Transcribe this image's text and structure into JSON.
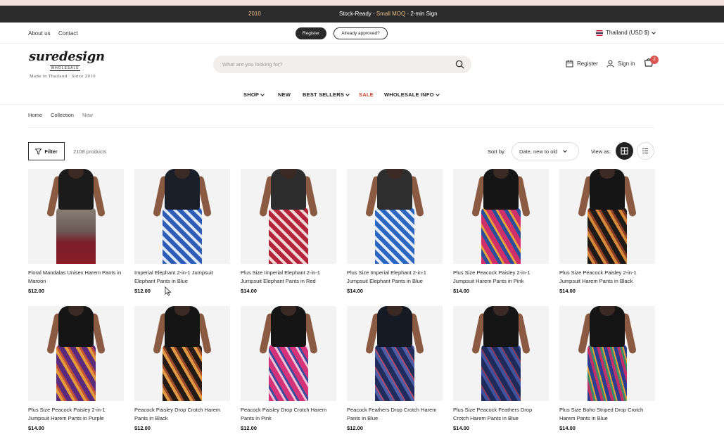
{
  "announcement": {
    "left_text": "2010",
    "text_before": "Stock-Ready · ",
    "text_accent": "Small MOQ",
    "text_after": " · 2-min Sign"
  },
  "utility": {
    "about": "About us",
    "contact": "Contact",
    "register": "Register",
    "approved": "Already approved?",
    "region": "Thailand (USD $)"
  },
  "header": {
    "logo_word": "suredesign",
    "logo_sub": "WHOLESALE",
    "logo_tag": "Made in Thailand · Since 2010",
    "search_placeholder": "What are you looking for?",
    "register": "Register",
    "signin": "Sign in",
    "cart_count": "2"
  },
  "nav": [
    {
      "label": "SHOP",
      "dropdown": true
    },
    {
      "label": "NEW",
      "dropdown": false
    },
    {
      "label": "BEST SELLERS",
      "dropdown": true
    },
    {
      "label": "SALE",
      "dropdown": false
    },
    {
      "label": "WHOLESALE INFO",
      "dropdown": true
    }
  ],
  "breadcrumb": {
    "home": "Home",
    "collection": "Collection",
    "current": "New"
  },
  "toolbar": {
    "filter": "Filter",
    "count": "2108 products",
    "sort_label": "Sort by:",
    "sort_value": "Date, new to old",
    "view_label": "View as:"
  },
  "products": [
    {
      "title": "Floral Mandalas Unisex Harem Pants in Maroon",
      "price": "$12.00",
      "top": "#1b1b1b",
      "pants": "linear-gradient(#8a7f77 0%, #6b5c58 40%, #7a1f2a 60%, #8a1c26 100%)"
    },
    {
      "title": "Imperial Elephant 2-in-1 Jumpsuit Elephant Pants in Blue",
      "price": "$12.00",
      "top": "#1a1f2a",
      "pants": "repeating-linear-gradient(45deg, #2c5cb8 0 6px, #dfe7f5 6px 10px)"
    },
    {
      "title": "Plus Size Imperial Elephant 2-in-1 Jumpsuit Elephant Pants in Red",
      "price": "$14.00",
      "top": "#2d2d2d",
      "pants": "repeating-linear-gradient(45deg, #b3243a 0 6px, #f1d6d6 6px 10px)"
    },
    {
      "title": "Plus Size Imperial Elephant 2-in-1 Jumpsuit Elephant Pants in Blue",
      "price": "$14.00",
      "top": "#2e2e2e",
      "pants": "repeating-linear-gradient(45deg, #2b66c2 0 6px, #e3ebf7 6px 10px)"
    },
    {
      "title": "Plus Size Peacock Paisley 2-in-1 Jumpsuit Harem Pants in Pink",
      "price": "$14.00",
      "top": "#151515",
      "pants": "repeating-linear-gradient(60deg, #d0306a 0 7px, #2a4e9b 7px 12px, #e8a23a 12px 15px)"
    },
    {
      "title": "Plus Size Peacock Paisley 2-in-1 Jumpsuit Harem Pants in Black",
      "price": "$14.00",
      "top": "#151515",
      "pants": "repeating-linear-gradient(60deg, #1e1a18 0 7px, #d48a3a 7px 11px, #8b3d26 11px 14px)"
    },
    {
      "title": "Plus Size Peacock Paisley 2-in-1 Jumpsuit Harem Pants in Purple",
      "price": "$14.00",
      "top": "#151515",
      "pants": "repeating-linear-gradient(60deg, #5a2a7d 0 7px, #e29a3a 7px 11px, #c0503a 11px 14px)"
    },
    {
      "title": "Peacock Paisley Drop Crotch Harem Pants in Black",
      "price": "$12.00",
      "top": "#151515",
      "pants": "repeating-linear-gradient(60deg, #231a16 0 7px, #e09a45 7px 11px, #9a4a2a 11px 14px)"
    },
    {
      "title": "Peacock Paisley Drop Crotch Harem Pants in Pink",
      "price": "$12.00",
      "top": "#151515",
      "pants": "repeating-linear-gradient(60deg, #d4337a 0 7px, #f3c2d6 7px 10px, #3a4c9b 10px 13px)"
    },
    {
      "title": "Peacock Feathers Drop Crotch Harem Pants in Blue",
      "price": "$12.00",
      "top": "#151a24",
      "pants": "repeating-linear-gradient(60deg, #1f2c5c 0 7px, #4a5fa8 7px 11px, #b04a6a 11px 13px)"
    },
    {
      "title": "Plus Size Peacock Feathers Drop Crotch Harem Pants in Blue",
      "price": "$14.00",
      "top": "#151515",
      "pants": "repeating-linear-gradient(60deg, #1d2a5a 0 7px, #3d54a0 7px 11px, #8a3a5a 11px 13px)"
    },
    {
      "title": "Plus Size Boho Striped Drop Crotch Harem Pants in Blue",
      "price": "$14.00",
      "top": "#151515",
      "pants": "repeating-linear-gradient(75deg, #2b3d8f 0 5px, #c2306a 5px 9px, #3b8a6a 9px 12px, #e0a03a 12px 14px)"
    }
  ]
}
